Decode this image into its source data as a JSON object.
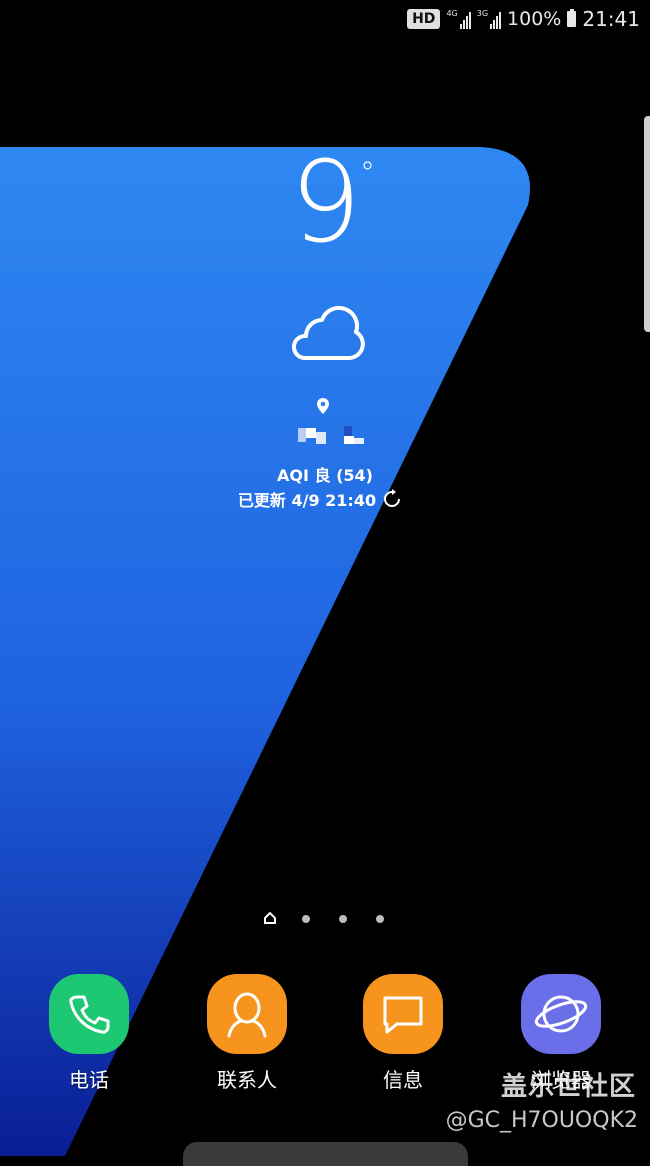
{
  "status_bar": {
    "hd": "HD",
    "net1": "4G",
    "net2": "3G",
    "battery": "100%",
    "time": "21:41"
  },
  "weather": {
    "temperature": "9",
    "degree": "°",
    "condition_icon": "cloud-icon",
    "aqi": "AQI 良 (54)",
    "updated": "已更新 4/9 21:40"
  },
  "pages": {
    "count": 4,
    "current": 0
  },
  "dock": {
    "apps": [
      {
        "label": "电话",
        "icon": "phone-icon",
        "color": "#1ec771"
      },
      {
        "label": "联系人",
        "icon": "contact-icon",
        "color": "#f7941d"
      },
      {
        "label": "信息",
        "icon": "message-icon",
        "color": "#f7941d"
      },
      {
        "label": "浏览器",
        "icon": "browser-icon",
        "color": "#6a6ee8"
      }
    ]
  },
  "watermark": {
    "site": "盖乐世社区",
    "user": "@GC_H7OUOQK2"
  },
  "colors": {
    "wallpaper_top": "#2f86ef",
    "wallpaper_bottom": "#0f2aa6",
    "background": "#000000"
  }
}
